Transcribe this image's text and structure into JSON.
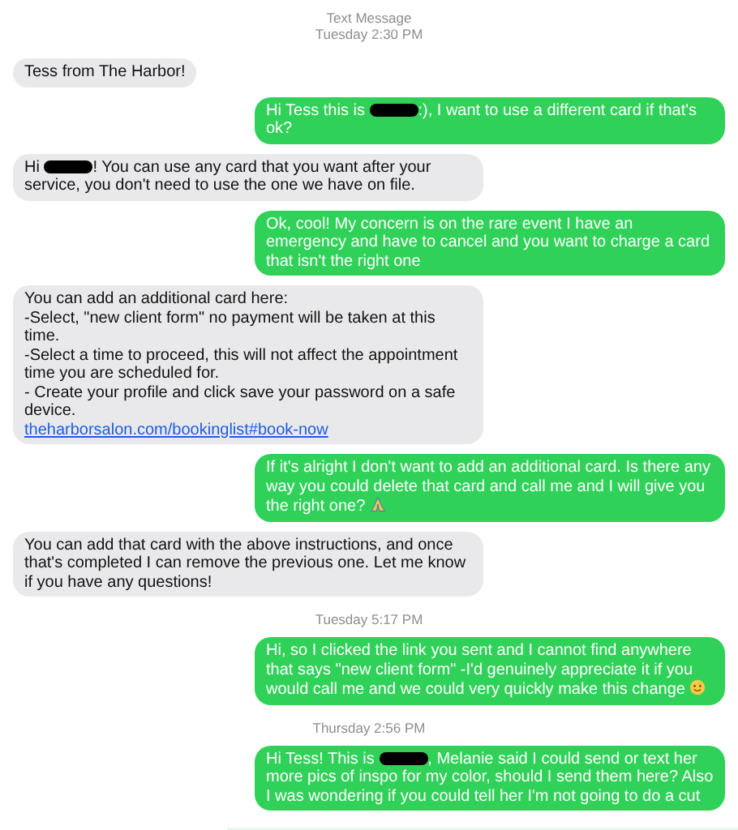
{
  "header": {
    "title": "Text Message",
    "time": "Tuesday 2:30 PM"
  },
  "items": [
    {
      "kind": "received",
      "parts": [
        {
          "kind": "text",
          "text": "Tess from The Harbor!"
        }
      ]
    },
    {
      "kind": "sent",
      "parts": [
        {
          "kind": "text",
          "text": "Hi Tess this is "
        },
        {
          "kind": "redaction"
        },
        {
          "kind": "text",
          "text": ":), I want to use a different card if that's ok?"
        }
      ]
    },
    {
      "kind": "received",
      "parts": [
        {
          "kind": "text",
          "text": "Hi "
        },
        {
          "kind": "redaction"
        },
        {
          "kind": "text",
          "text": "! You can use any card that you want after your service, you don't need to use the one we have on file."
        }
      ]
    },
    {
      "kind": "sent",
      "parts": [
        {
          "kind": "text",
          "text": "Ok, cool! My concern is on the rare event I have an emergency and have to cancel and you want to charge a card that isn't the right one"
        }
      ]
    },
    {
      "kind": "received",
      "parts": [
        {
          "kind": "text",
          "text": "You can add an additional card here:\n-Select, \"new client form\" no payment will be taken at this time.\n-Select a time to proceed, this will not affect the appointment time you are scheduled for.\n- Create your profile and click save your password on a safe device.\n"
        },
        {
          "kind": "link",
          "text": "theharborsalon.com/bookinglist#book-now"
        }
      ]
    },
    {
      "kind": "sent",
      "parts": [
        {
          "kind": "text",
          "text": "If it's alright I don't want to add an additional card. Is there any way you could delete that card and call me and I will give you the right one? "
        },
        {
          "kind": "pray-emoji"
        }
      ]
    },
    {
      "kind": "received",
      "parts": [
        {
          "kind": "text",
          "text": "You can add that card with the above instructions, and once that's completed I can remove the previous one. Let me know if you have any questions!"
        }
      ]
    },
    {
      "kind": "time",
      "text": "Tuesday 5:17 PM"
    },
    {
      "kind": "sent",
      "parts": [
        {
          "kind": "text",
          "text": "Hi, so I clicked the link you sent and I cannot find anywhere that says \"new client form\" -I'd genuinely appreciate it if you would call me and we could very quickly make this change "
        },
        {
          "kind": "smile-emoji"
        }
      ]
    },
    {
      "kind": "time",
      "text": "Thursday 2:56 PM"
    },
    {
      "kind": "sent",
      "parts": [
        {
          "kind": "text",
          "text": "Hi Tess! This is "
        },
        {
          "kind": "redaction"
        },
        {
          "kind": "text",
          "text": ", Melanie said I could send or text her more pics of inspo for my color, should I send them here? Also I was wondering if you could tell her I'm not going to do a cut"
        }
      ]
    }
  ]
}
